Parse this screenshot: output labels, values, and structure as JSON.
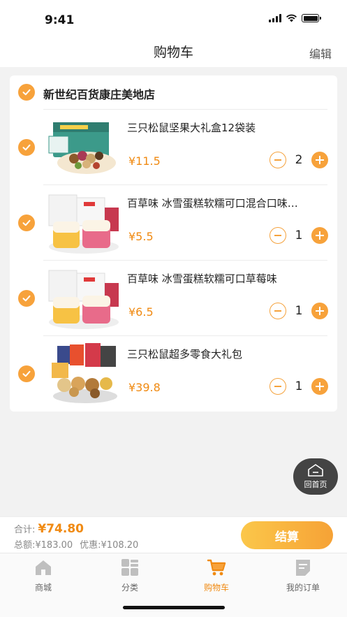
{
  "status": {
    "time": "9:41"
  },
  "header": {
    "title": "购物车",
    "edit_label": "编辑"
  },
  "store": {
    "name": "新世纪百货康庄美地店",
    "checked": true
  },
  "items": [
    {
      "title": "三只松鼠坚果大礼盒12袋装",
      "price": "¥11.5",
      "qty": "2",
      "checked": true
    },
    {
      "title": "百草味 冰雪蛋糕软糯可口混合口味早餐",
      "price": "¥5.5",
      "qty": "1",
      "checked": true
    },
    {
      "title": "百草味 冰雪蛋糕软糯可口草莓味",
      "price": "¥6.5",
      "qty": "1",
      "checked": true
    },
    {
      "title": "三只松鼠超多零食大礼包",
      "price": "¥39.8",
      "qty": "1",
      "checked": true
    }
  ],
  "float_button": {
    "label": "回首页"
  },
  "checkout": {
    "total_label": "合计:",
    "total_value": "¥74.80",
    "sum_text": "总额:¥183.00",
    "discount_text": "优惠:¥108.20",
    "pay_label": "结算"
  },
  "tabs": [
    {
      "label": "商城",
      "icon": "home-icon"
    },
    {
      "label": "分类",
      "icon": "grid-icon"
    },
    {
      "label": "购物车",
      "icon": "cart-icon",
      "active": true
    },
    {
      "label": "我的订单",
      "icon": "order-icon"
    }
  ],
  "colors": {
    "accent": "#f7a23b",
    "price": "#f08a12"
  }
}
